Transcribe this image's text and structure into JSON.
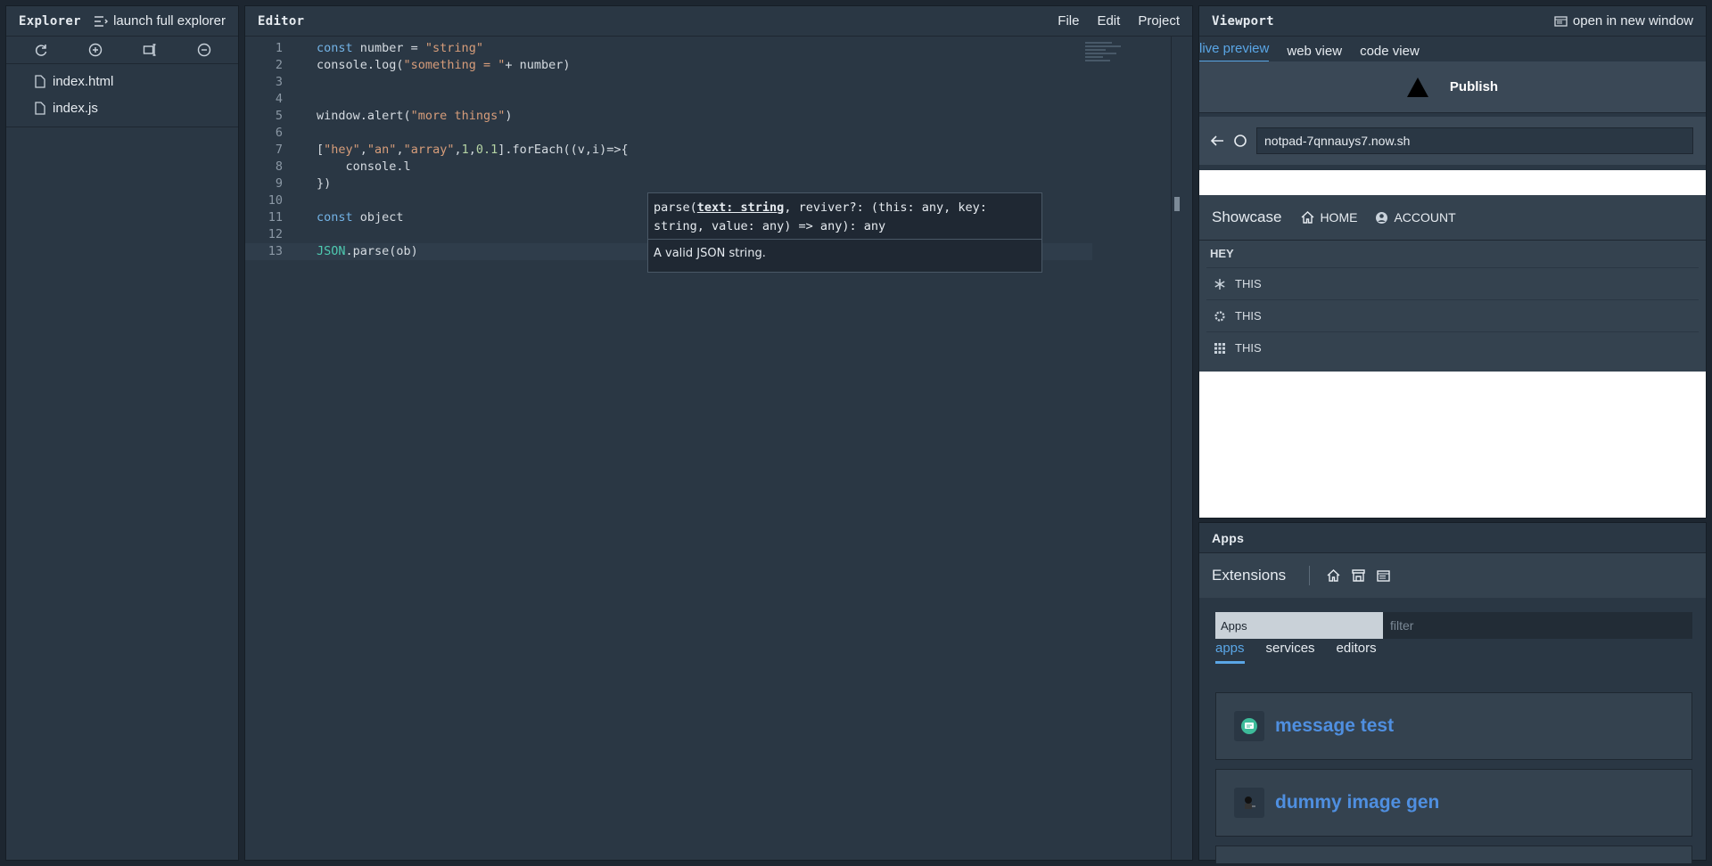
{
  "explorer": {
    "title": "Explorer",
    "launch_label": "launch full explorer",
    "files": [
      "index.html",
      "index.js"
    ]
  },
  "editor": {
    "title": "Editor",
    "menu": [
      "File",
      "Edit",
      "Project"
    ],
    "lines": [
      {
        "n": "1",
        "html": "<span class='kw'>const</span> number = <span class='str'>\"string\"</span>"
      },
      {
        "n": "2",
        "html": "console.log(<span class='str'>\"something = \"</span>+ number)"
      },
      {
        "n": "3",
        "html": ""
      },
      {
        "n": "4",
        "html": ""
      },
      {
        "n": "5",
        "html": "window.alert(<span class='str'>\"more things\"</span>)"
      },
      {
        "n": "6",
        "html": ""
      },
      {
        "n": "7",
        "html": "[<span class='str'>\"hey\"</span>,<span class='str'>\"an\"</span>,<span class='str'>\"array\"</span>,<span class='num'>1</span>,<span class='num'>0.1</span>].forEach((v,i)=>{"
      },
      {
        "n": "8",
        "html": "    console.l"
      },
      {
        "n": "9",
        "html": "})"
      },
      {
        "n": "10",
        "html": ""
      },
      {
        "n": "11",
        "html": "<span class='kw'>const</span> object"
      },
      {
        "n": "12",
        "html": ""
      },
      {
        "n": "13",
        "html": "<span class='cls'>JSON</span>.parse(ob)"
      }
    ],
    "tooltip": {
      "sig_pre": "parse(",
      "sig_param": "text: string",
      "sig_post": ", reviver?: (this: any, key: string, value: any) => any): any",
      "doc": "A valid JSON string."
    }
  },
  "viewport": {
    "title": "Viewport",
    "open_label": "open in new window",
    "tabs": [
      "live preview",
      "web view",
      "code view"
    ],
    "publish_label": "Publish",
    "url": "notpad-7qnnauys7.now.sh",
    "nav": {
      "brand": "Showcase",
      "home": "HOME",
      "account": "ACCOUNT"
    },
    "list_head": "HEY",
    "list_items": [
      "THIS",
      "THIS",
      "THIS"
    ]
  },
  "apps": {
    "title": "Apps",
    "extensions_label": "Extensions",
    "select_value": "Apps",
    "filter_placeholder": "filter",
    "tabs": [
      "apps",
      "services",
      "editors"
    ],
    "cards": [
      "message test",
      "dummy image gen"
    ]
  }
}
